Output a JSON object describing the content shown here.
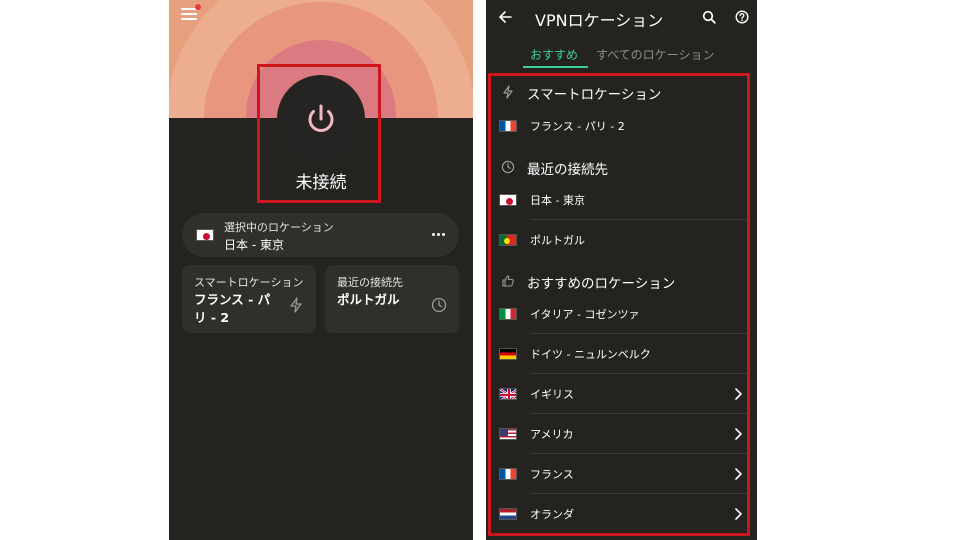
{
  "left": {
    "status": "未接続",
    "selected_location": {
      "label": "選択中のロケーション",
      "value": "日本 - 東京",
      "flag": "jp"
    },
    "smart": {
      "title": "スマートロケーション",
      "value_line1": "フランス - パ",
      "value_line2": "リ - 2",
      "icon": "bolt-icon"
    },
    "recent": {
      "title": "最近の接続先",
      "value": "ポルトガル",
      "icon": "clock-icon"
    }
  },
  "right": {
    "title": "VPNロケーション",
    "tabs": [
      {
        "label": "おすすめ",
        "active": true
      },
      {
        "label": "すべてのロケーション",
        "active": false
      }
    ],
    "sections": {
      "smart": {
        "title": "スマートロケーション",
        "icon": "bolt-icon"
      },
      "recent": {
        "title": "最近の接続先",
        "icon": "clock-icon"
      },
      "recommended": {
        "title": "おすすめのロケーション",
        "icon": "thumbs-up-icon"
      }
    },
    "rows": [
      {
        "label": "フランス - パリ - 2",
        "flag": "fr"
      },
      {
        "label": "日本 - 東京",
        "flag": "jp"
      },
      {
        "label": "ポルトガル",
        "flag": "pt"
      },
      {
        "label": "イタリア - コゼンツァ",
        "flag": "it"
      },
      {
        "label": "ドイツ - ニュルンベルク",
        "flag": "de"
      },
      {
        "label": "イギリス",
        "flag": "gb"
      },
      {
        "label": "アメリカ",
        "flag": "us"
      },
      {
        "label": "フランス",
        "flag": "fr"
      },
      {
        "label": "オランダ",
        "flag": "nl"
      }
    ]
  },
  "colors": {
    "accent": "#3ecf99",
    "highlight": "#d0161d",
    "background": "#252320",
    "card": "#312f2c"
  }
}
